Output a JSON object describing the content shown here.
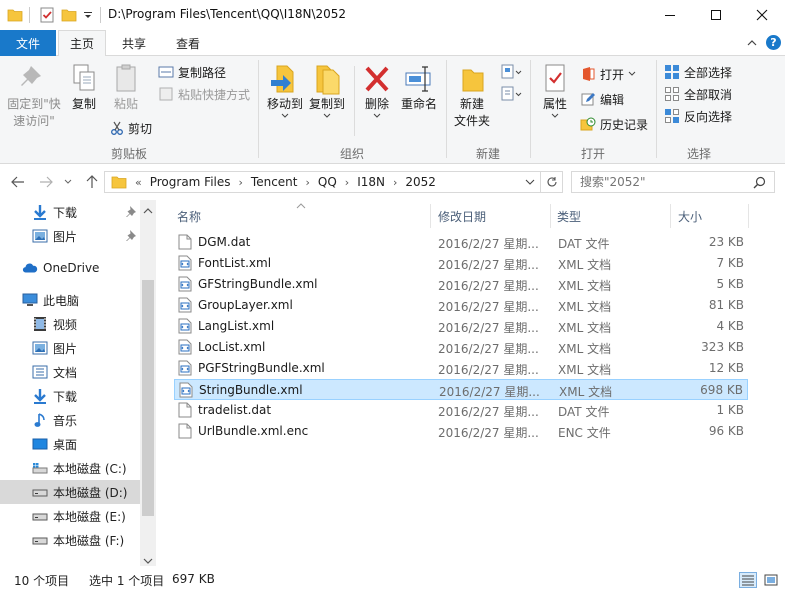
{
  "window": {
    "title": "D:\\Program Files\\Tencent\\QQ\\I18N\\2052"
  },
  "tabs": {
    "file": "文件",
    "home": "主页",
    "share": "共享",
    "view": "查看"
  },
  "ribbon": {
    "clipboard": {
      "pin": "固定到\"快\n速访问\"",
      "pin_line1": "固定到\"快",
      "pin_line2": "速访问\"",
      "copy": "复制",
      "paste": "粘贴",
      "copy_path": "复制路径",
      "paste_shortcut": "粘贴快捷方式",
      "cut": "剪切",
      "label": "剪贴板"
    },
    "organize": {
      "move_to": "移动到",
      "copy_to": "复制到",
      "delete": "删除",
      "rename": "重命名",
      "label": "组织"
    },
    "new": {
      "new_folder_line1": "新建",
      "new_folder_line2": "文件夹",
      "label": "新建"
    },
    "open": {
      "properties": "属性",
      "open": "打开",
      "edit": "编辑",
      "history": "历史记录",
      "label": "打开"
    },
    "select": {
      "select_all": "全部选择",
      "select_none": "全部取消",
      "invert": "反向选择",
      "label": "选择"
    }
  },
  "address": {
    "crumbs": [
      "Program Files",
      "Tencent",
      "QQ",
      "I18N",
      "2052"
    ],
    "search_placeholder": "搜索\"2052\""
  },
  "nav": {
    "items": [
      {
        "label": "下载",
        "icon": "download-icon",
        "pinned": true
      },
      {
        "label": "图片",
        "icon": "pictures-icon",
        "pinned": true
      },
      {
        "label": "OneDrive",
        "icon": "onedrive-icon"
      },
      {
        "label": "此电脑",
        "icon": "this-pc-icon"
      },
      {
        "label": "视频",
        "icon": "videos-icon"
      },
      {
        "label": "图片",
        "icon": "pictures-icon"
      },
      {
        "label": "文档",
        "icon": "documents-icon"
      },
      {
        "label": "下载",
        "icon": "download-icon"
      },
      {
        "label": "音乐",
        "icon": "music-icon"
      },
      {
        "label": "桌面",
        "icon": "desktop-icon"
      },
      {
        "label": "本地磁盘 (C:)",
        "icon": "windows-drive-icon"
      },
      {
        "label": "本地磁盘 (D:)",
        "icon": "drive-icon",
        "selected": true
      },
      {
        "label": "本地磁盘 (E:)",
        "icon": "drive-icon"
      },
      {
        "label": "本地磁盘 (F:)",
        "icon": "drive-icon"
      }
    ]
  },
  "columns": {
    "name": "名称",
    "date": "修改日期",
    "type": "类型",
    "size": "大小"
  },
  "files": [
    {
      "name": "DGM.dat",
      "date": "2016/2/27 星期...",
      "type": "DAT 文件",
      "size": "23 KB",
      "kind": "dat"
    },
    {
      "name": "FontList.xml",
      "date": "2016/2/27 星期...",
      "type": "XML 文档",
      "size": "7 KB",
      "kind": "xml"
    },
    {
      "name": "GFStringBundle.xml",
      "date": "2016/2/27 星期...",
      "type": "XML 文档",
      "size": "5 KB",
      "kind": "xml"
    },
    {
      "name": "GroupLayer.xml",
      "date": "2016/2/27 星期...",
      "type": "XML 文档",
      "size": "81 KB",
      "kind": "xml"
    },
    {
      "name": "LangList.xml",
      "date": "2016/2/27 星期...",
      "type": "XML 文档",
      "size": "4 KB",
      "kind": "xml"
    },
    {
      "name": "LocList.xml",
      "date": "2016/2/27 星期...",
      "type": "XML 文档",
      "size": "323 KB",
      "kind": "xml"
    },
    {
      "name": "PGFStringBundle.xml",
      "date": "2016/2/27 星期...",
      "type": "XML 文档",
      "size": "12 KB",
      "kind": "xml"
    },
    {
      "name": "StringBundle.xml",
      "date": "2016/2/27 星期...",
      "type": "XML 文档",
      "size": "698 KB",
      "kind": "xml",
      "selected": true
    },
    {
      "name": "tradelist.dat",
      "date": "2016/2/27 星期...",
      "type": "DAT 文件",
      "size": "1 KB",
      "kind": "dat"
    },
    {
      "name": "UrlBundle.xml.enc",
      "date": "2016/2/27 星期...",
      "type": "ENC 文件",
      "size": "96 KB",
      "kind": "dat"
    }
  ],
  "status": {
    "count": "10 个项目",
    "selected": "选中 1 个项目",
    "size": "697 KB"
  },
  "colors": {
    "accent": "#1979ca",
    "selection": "#cce8ff",
    "selection_border": "#99d1ff"
  }
}
